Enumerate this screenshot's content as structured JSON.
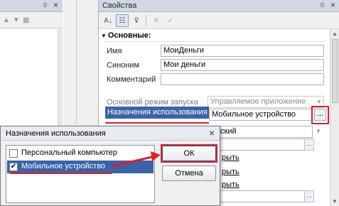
{
  "left_panel": {
    "pin": "0",
    "close": "×"
  },
  "properties": {
    "title": "Свойства",
    "pin": "0",
    "close": "×",
    "group": "Основные:",
    "rows": {
      "name_label": "Имя",
      "name_value": "МоиДеньги",
      "synonym_label": "Синоним",
      "synonym_value": "Мои деньги",
      "comment_label": "Комментарий",
      "comment_value": "",
      "launch_label": "Основной режим запуска",
      "launch_value": "Управляемое приложение",
      "purpose_label": "Назначения использования",
      "purpose_value": "Мобильное устройство",
      "row_language_value": "ский",
      "link1": "рыть",
      "link2": "рыть",
      "link3": "рыть",
      "link4": "рыть",
      "ellipsis": "..."
    }
  },
  "dialog": {
    "title": "Назначения использования",
    "close": "×",
    "items": [
      {
        "label": "Персональный компьютер",
        "checked": false
      },
      {
        "label": "Мобильное устройство",
        "checked": true
      }
    ],
    "ok_label": "ОК",
    "cancel_label": "Отмена",
    "check_mark": "✔"
  },
  "colors": {
    "highlight": "#3a63a8",
    "annotation_red": "#e02020"
  }
}
